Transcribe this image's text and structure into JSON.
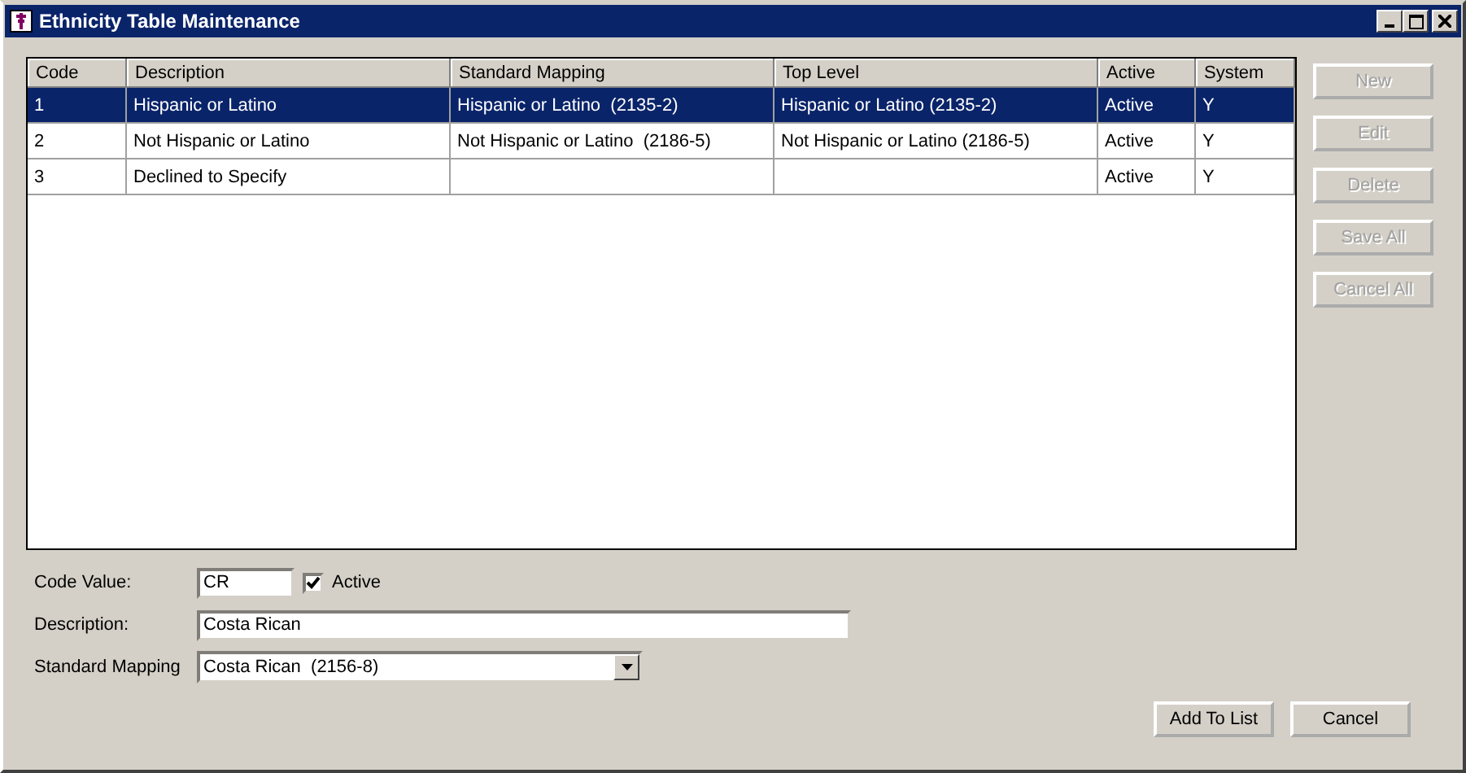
{
  "window": {
    "title": "Ethnicity Table Maintenance"
  },
  "table": {
    "columns": [
      "Code",
      "Description",
      "Standard Mapping",
      "Top Level",
      "Active",
      "System"
    ],
    "rows": [
      {
        "cells": [
          "1",
          "Hispanic or Latino",
          "Hispanic or Latino  (2135-2)",
          "Hispanic or Latino (2135-2)",
          "Active",
          "Y"
        ],
        "selected": true
      },
      {
        "cells": [
          "2",
          "Not Hispanic or Latino",
          "Not Hispanic or Latino  (2186-5)",
          "Not Hispanic or Latino (2186-5)",
          "Active",
          "Y"
        ],
        "selected": false
      },
      {
        "cells": [
          "3",
          "Declined to Specify",
          "",
          "",
          "Active",
          "Y"
        ],
        "selected": false
      }
    ]
  },
  "side_buttons": [
    {
      "label": "New",
      "disabled": true
    },
    {
      "label": "Edit",
      "disabled": true
    },
    {
      "label": "Delete",
      "disabled": true
    },
    {
      "label": "Save All",
      "disabled": true
    },
    {
      "label": "Cancel All",
      "disabled": true
    }
  ],
  "form": {
    "code_label": "Code Value:",
    "code_value": "CR",
    "active_label": "Active",
    "active_checked": true,
    "description_label": "Description:",
    "description_value": "Costa Rican",
    "mapping_label": "Standard Mapping",
    "mapping_value": "Costa Rican  (2156-8)"
  },
  "bottom_buttons": [
    {
      "label": "Add To List",
      "disabled": false
    },
    {
      "label": "Cancel",
      "disabled": false
    }
  ]
}
